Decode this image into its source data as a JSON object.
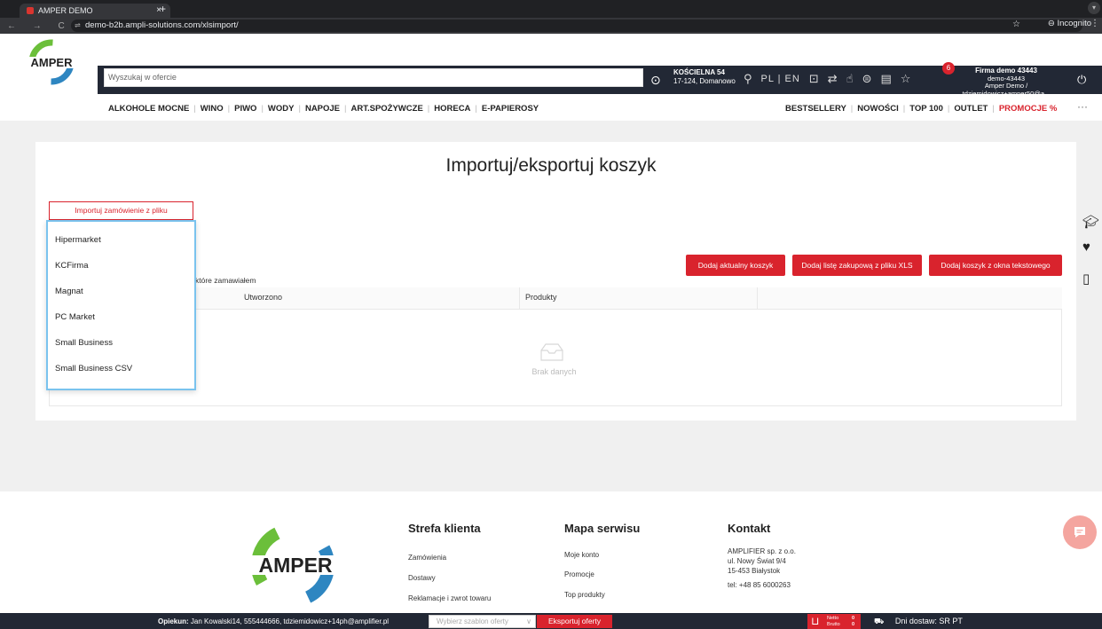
{
  "browser": {
    "tab_title": "AMPER DEMO",
    "tab_close": "×",
    "new_tab": "+",
    "nav_buttons": "←  →  C",
    "url": "demo-b2b.ampli-solutions.com/xlsimport/",
    "incognito": "Incognito"
  },
  "header": {
    "search_placeholder": "Wyszukaj w ofercie",
    "address_line1": "KOŚCIELNA 54",
    "address_line2": "17-124, Domanowo",
    "lang": "PL | EN",
    "notifications_count": "6",
    "firm_line1": "Firma demo 43443",
    "firm_line2": "demo-43443",
    "firm_line3": "Amper Demo / tdziemidowicz+amper50@a..."
  },
  "nav": {
    "categories": [
      "ALKOHOLE MOCNE",
      "WINO",
      "PIWO",
      "WODY",
      "NAPOJE",
      "ART.SPOŻYWCZE",
      "HORECA",
      "E-PAPIEROSY"
    ],
    "right": [
      "BESTSELLERY",
      "NOWOŚCI",
      "TOP 100",
      "OUTLET"
    ],
    "promo": "PROMOCJE %",
    "more": "···"
  },
  "main": {
    "title": "Importuj/eksportuj koszyk",
    "import_button": "Importuj zamówienie z pliku",
    "history_label": "które zamawiałem",
    "buttons": {
      "add_current_cart": "Dodaj aktualny koszyk",
      "add_xls_list": "Dodaj listę zakupową z pliku XLS",
      "add_text_cart": "Dodaj koszyk z okna tekstowego"
    },
    "table": {
      "col_created": "Utworzono",
      "col_products": "Produkty",
      "empty": "Brak danych"
    }
  },
  "dropdown": {
    "items": [
      "Hipermarket",
      "KCFirma",
      "Magnat",
      "PC Market",
      "Small Business",
      "Small Business CSV"
    ]
  },
  "footer": {
    "client_zone": {
      "title": "Strefa klienta",
      "links": [
        "Zamówienia",
        "Dostawy",
        "Reklamacje i zwrot towaru"
      ]
    },
    "sitemap": {
      "title": "Mapa serwisu",
      "links": [
        "Moje konto",
        "Promocje",
        "Top produkty"
      ]
    },
    "contact": {
      "title": "Kontakt",
      "lines": [
        "AMPLIFIER sp. z o.o.",
        "ul. Nowy Świat 9/4",
        "15-453 Białystok",
        "tel: +48 85 6000263"
      ]
    }
  },
  "bottombar": {
    "opiekun_label": "Opiekun:",
    "opiekun_value": "Jan Kowalski14, 555444666, tdziemidowicz+14ph@amplifier.pl",
    "template_placeholder": "Wybierz szablon oferty",
    "export_button": "Eksportuj oferty",
    "cart_netto_label": "Netto",
    "cart_brutto_label": "Brutto",
    "cart_netto_value": "0",
    "cart_brutto_value": "0",
    "delivery": "Dni dostaw: SR PT"
  },
  "colors": {
    "brand_red": "#d9232d",
    "header_dark": "#222835",
    "dropdown_border": "#7ac3ee"
  }
}
